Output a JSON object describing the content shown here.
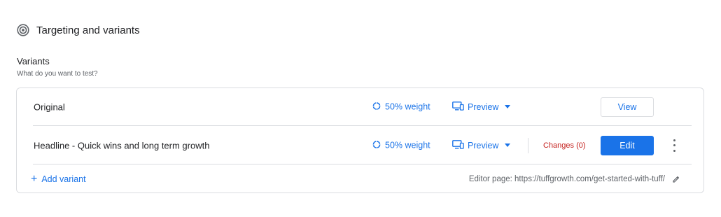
{
  "section": {
    "title": "Targeting and variants",
    "icon": "target-icon"
  },
  "variants": {
    "label": "Variants",
    "subtitle": "What do you want to test?",
    "rows": [
      {
        "name": "Original",
        "weight": "50% weight",
        "preview_label": "Preview",
        "action_label": "View"
      },
      {
        "name": "Headline - Quick wins and long term growth",
        "weight": "50% weight",
        "preview_label": "Preview",
        "changes_label": "Changes (0)",
        "action_label": "Edit"
      }
    ],
    "add_label": "Add variant",
    "editor_page": "Editor page: https://tuffgrowth.com/get-started-with-tuff/"
  },
  "colors": {
    "accent": "#1a73e8",
    "changes": "#c5221f",
    "border": "#dadce0",
    "muted_text": "#5f6368"
  }
}
